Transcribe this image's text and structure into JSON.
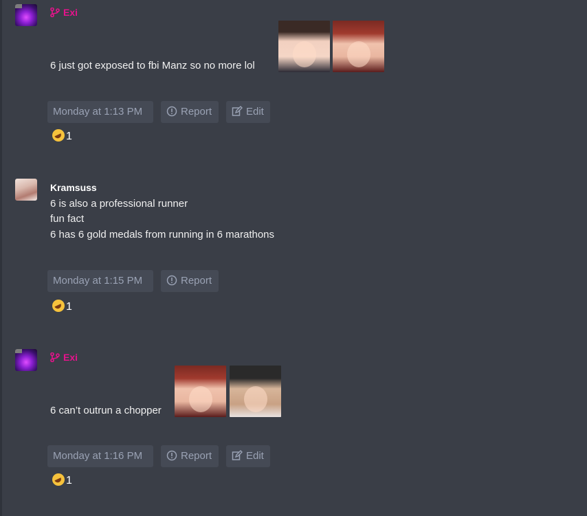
{
  "posts": [
    {
      "author": "Exi",
      "lines": [
        "6 just got exposed to fbi Manz so no more lol"
      ],
      "timestamp": "Monday at 1:13 PM",
      "report_label": "Report",
      "edit_label": "Edit",
      "reaction_count": "1"
    },
    {
      "author": "Kramsuss",
      "lines": [
        "6 is also a professional runner",
        "fun fact",
        "6 has 6 gold medals from running in 6 marathons"
      ],
      "timestamp": "Monday at 1:15 PM",
      "report_label": "Report",
      "reaction_count": "1"
    },
    {
      "author": "Exi",
      "lines": [
        "6 can’t outrun a chopper"
      ],
      "timestamp": "Monday at 1:16 PM",
      "report_label": "Report",
      "edit_label": "Edit",
      "reaction_count": "1"
    }
  ],
  "colors": {
    "background": "#3a3e47",
    "exi_name": "#e6138c",
    "button_bg": "#454a55",
    "button_text": "#9aa2b4"
  },
  "icons": {
    "branch": "git-branch-icon",
    "report": "alert-circle-icon",
    "edit": "edit-icon",
    "reaction": "rofl-emoji-icon"
  }
}
